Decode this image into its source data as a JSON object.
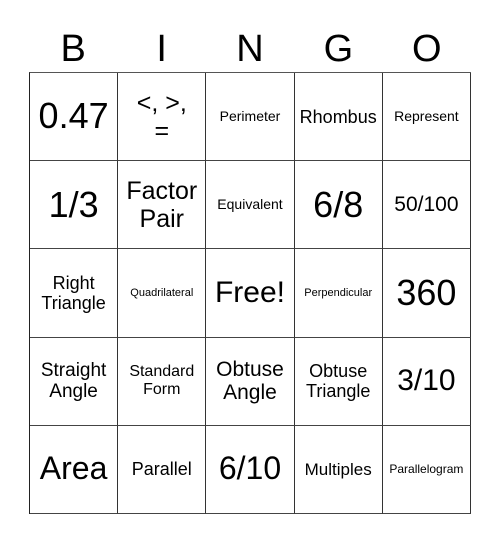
{
  "card": {
    "header_letters": [
      "B",
      "I",
      "N",
      "G",
      "O"
    ],
    "rows": [
      [
        "0.47",
        "<, >, =",
        "Perimeter",
        "Rhombus",
        "Represent"
      ],
      [
        "1/3",
        "Factor Pair",
        "Equivalent",
        "6/8",
        "50/100"
      ],
      [
        "Right Triangle",
        "Quadrilateral",
        "Free!",
        "Perpendicular",
        "360"
      ],
      [
        "Straight Angle",
        "Standard Form",
        "Obtuse Angle",
        "Obtuse Triangle",
        "3/10"
      ],
      [
        "Area",
        "Parallel",
        "6/10",
        "Multiples",
        "Parallelogram"
      ]
    ],
    "free_space_label": "Free!",
    "border_color": "#333333",
    "text_color": "#000000",
    "background_color": "#ffffff"
  }
}
